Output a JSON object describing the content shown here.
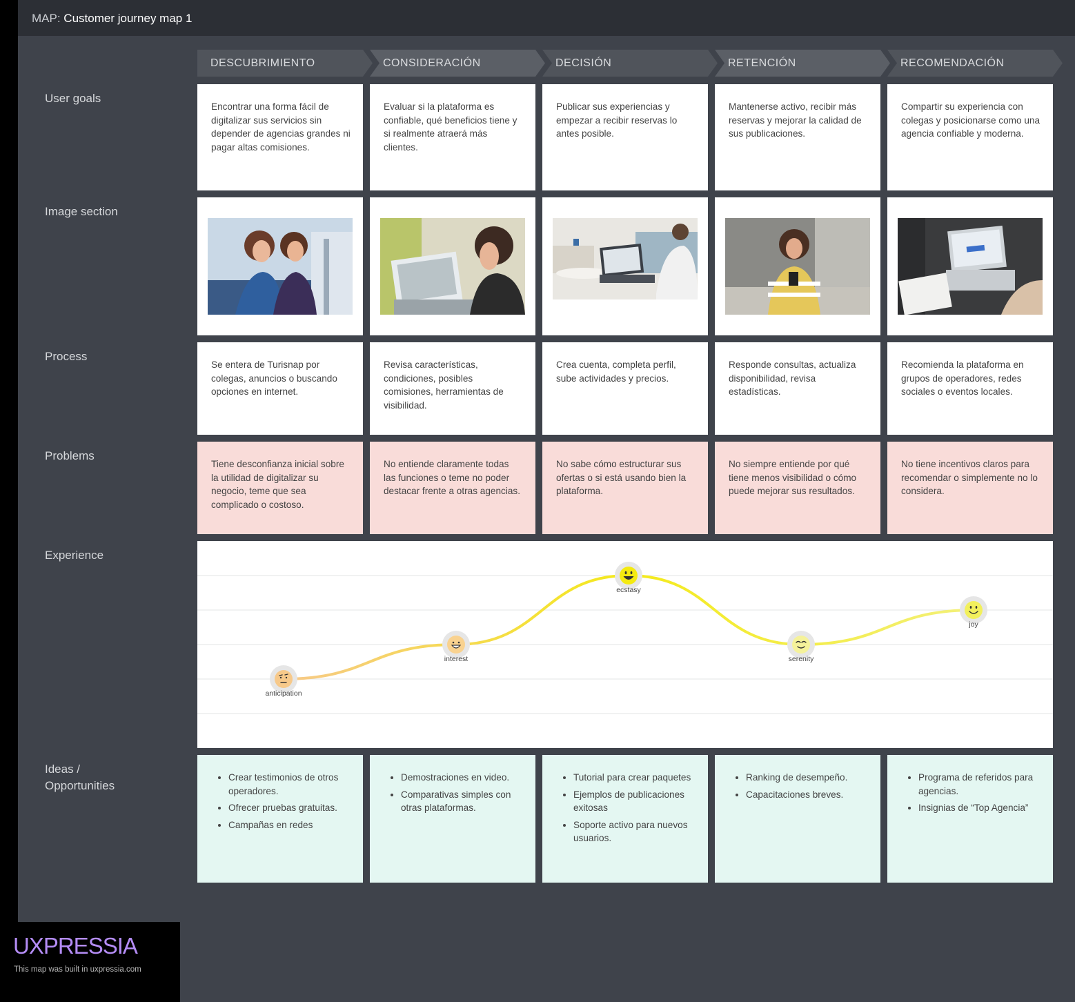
{
  "map": {
    "prefix": "MAP:",
    "title": "Customer journey map 1"
  },
  "stages": [
    "DESCUBRIMIENTO",
    "CONSIDERACIÓN",
    "DECISIÓN",
    "RETENCIÓN",
    "RECOMENDACIÓN"
  ],
  "rows": {
    "user_goals": "User goals",
    "image_section": "Image section",
    "process": "Process",
    "problems": "Problems",
    "experience": "Experience",
    "ideas_line1": "Ideas /",
    "ideas_line2": "Opportunities"
  },
  "user_goals": [
    "Encontrar una forma fácil de digitalizar sus servicios sin depender de agencias grandes ni pagar altas comisiones.",
    "Evaluar si la plataforma es confiable, qué beneficios tiene y si realmente atraerá más clientes.",
    "Publicar sus experiencias y empezar a recibir reservas lo antes posible.",
    "Mantenerse activo, recibir más reservas y mejorar la calidad de sus publicaciones.",
    "Compartir su experiencia con colegas y posicionarse como una agencia confiable y moderna."
  ],
  "process": [
    "Se entera de Turisnap por colegas, anuncios o buscando opciones en internet.",
    "Revisa características, condiciones, posibles comisiones, herramientas de visibilidad.",
    "Crea cuenta, completa perfil, sube actividades y precios.",
    "Responde consultas, actualiza disponibilidad, revisa estadísticas.",
    "Recomienda la plataforma en grupos de operadores, redes sociales o eventos locales."
  ],
  "problems": [
    "Tiene desconfianza inicial sobre la utilidad de digitalizar su negocio, teme que sea complicado o costoso.",
    "No entiende claramente todas las funciones o teme no poder destacar frente a otras agencias.",
    "No sabe cómo estructurar sus ofertas o si está usando bien la plataforma.",
    "No siempre entiende por qué tiene menos visibilidad o cómo puede mejorar sus resultados.",
    "No tiene incentivos claros para recomendar o simplemente no lo considera."
  ],
  "experience": [
    {
      "emotion": "anticipation",
      "level": 1,
      "face": "skeptical-face-icon",
      "color": "#f7c98a"
    },
    {
      "emotion": "interest",
      "level": 2,
      "face": "grin-face-icon",
      "color": "#f9d28f"
    },
    {
      "emotion": "ecstasy",
      "level": 4,
      "face": "big-smile-face-icon",
      "color": "#f4ea10"
    },
    {
      "emotion": "serenity",
      "level": 2,
      "face": "content-face-icon",
      "color": "#f5f29a"
    },
    {
      "emotion": "joy",
      "level": 3,
      "face": "smile-face-icon",
      "color": "#f2f05c"
    }
  ],
  "ideas": [
    [
      "Crear testimonios de otros operadores.",
      "Ofrecer pruebas gratuitas.",
      "Campañas en redes"
    ],
    [
      "Demostraciones en video.",
      "Comparativas simples con otras plataformas."
    ],
    [
      "Tutorial para crear paquetes",
      "Ejemplos de publicaciones exitosas",
      "Soporte activo para nuevos usuarios."
    ],
    [
      "Ranking de desempeño.",
      "Capacitaciones breves."
    ],
    [
      "Programa de referidos para agencias.",
      "Insignias de “Top Agencia”"
    ]
  ],
  "footer": {
    "brand": "UXPRESSIA",
    "note": "This map was built in uxpressia.com"
  }
}
